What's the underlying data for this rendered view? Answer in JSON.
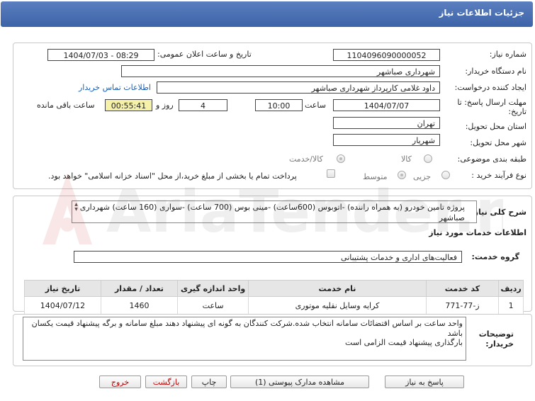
{
  "header": {
    "title": "جزئیات اطلاعات نیاز"
  },
  "form": {
    "need_number_label": "شماره نیاز:",
    "need_number": "1104096090000052",
    "announce_label": "تاریخ و ساعت اعلان عمومی:",
    "announce_value": "1404/07/03 - 08:29",
    "buyer_org_label": "نام دستگاه خریدار:",
    "buyer_org": "شهرداری صباشهر",
    "creator_label": "ایجاد کننده درخواست:",
    "creator": "داود غلامی کارپرداز شهرداری صباشهر",
    "contact_link": "اطلاعات تماس خریدار",
    "deadline_label_1": "مهلت ارسال پاسخ: تا",
    "deadline_label_2": "تاریخ:",
    "deadline_date": "1404/07/07",
    "time_label": "ساعت",
    "deadline_time": "10:00",
    "days_value": "4",
    "days_label": "روز و",
    "remaining_time": "00:55:41",
    "remaining_label": "ساعت باقی مانده",
    "province_label": "استان محل تحویل:",
    "province": "تهران",
    "city_label": "شهر محل تحویل:",
    "city": "شهریار",
    "category_label": "طبقه بندی موضوعی:",
    "category_options": [
      "کالا",
      "کالا/خدمت"
    ],
    "process_label": "نوع فرآیند خرید :",
    "process_options": [
      "جزیی",
      "متوسط"
    ],
    "treasury_note": "پرداخت تمام یا بخشی از مبلغ خرید،از محل \"اسناد خزانه اسلامی\" خواهد بود."
  },
  "description": {
    "label": "شرح کلی نیاز:",
    "text": "پروژه تامین خودرو (به همراه راننده) -اتوبوس  (600ساعت) -مینی بوس (700 ساعت) -سواری  (160 ساعت)  شهرداری صباشهر"
  },
  "services": {
    "section_title": "اطلاعات خدمات مورد نیاز",
    "group_label": "گروه خدمت:",
    "group_value": "فعالیت‌های اداری و خدمات پشتیبانی",
    "columns": [
      "ردیف",
      "کد خدمت",
      "نام خدمت",
      "واحد اندازه گیری",
      "تعداد / مقدار",
      "تاریخ نیاز"
    ],
    "rows": [
      {
        "row": "1",
        "code": "ز-77-771",
        "name": "کرایه وسایل نقلیه موتوری",
        "unit": "ساعت",
        "qty": "1460",
        "date": "1404/07/12"
      }
    ]
  },
  "buyer_notes": {
    "label_1": "توضیحات",
    "label_2": "خریدار:",
    "lines": [
      "واحد ساعت بر اساس اقتضائات سامانه انتخاب شده.شرکت کنندگان به گونه ای پیشنهاد دهند مبلغ سامانه و برگه پیشنهاد قیمت یکسان باشد",
      "بارگذاری پیشنهاد قیمت الزامی است"
    ]
  },
  "buttons": {
    "reply": "پاسخ به نیاز",
    "attachments": "مشاهده مدارک پیوستی (1)",
    "print": "چاپ",
    "back": "بازگشت",
    "exit": "خروج"
  },
  "watermark": {
    "text": "AriaTender.net"
  },
  "colors": {
    "header": "#4a6fb5",
    "highlight": "#f5f1a8",
    "link": "#1a5fb4",
    "danger": "#c00000"
  }
}
